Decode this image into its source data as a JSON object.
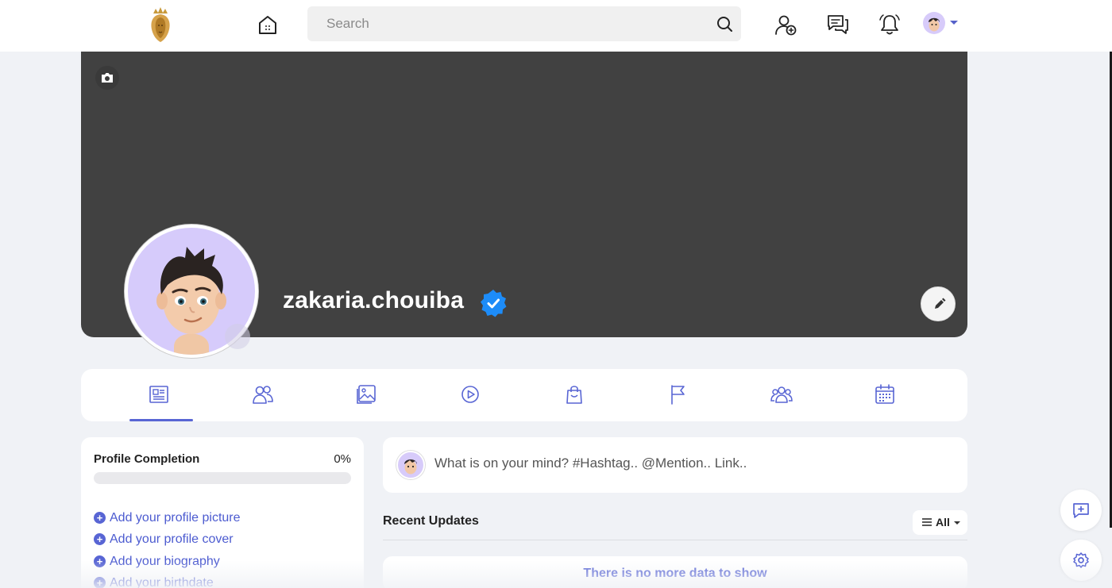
{
  "header": {
    "search_placeholder": "Search"
  },
  "profile": {
    "username": "zakaria.chouiba",
    "verified": true
  },
  "tabs": [
    {
      "icon": "news-feed-icon",
      "active": true
    },
    {
      "icon": "friends-icon"
    },
    {
      "icon": "photos-icon"
    },
    {
      "icon": "videos-icon"
    },
    {
      "icon": "shop-bag-icon"
    },
    {
      "icon": "pages-flag-icon"
    },
    {
      "icon": "groups-icon"
    },
    {
      "icon": "events-calendar-icon"
    }
  ],
  "profile_completion": {
    "title": "Profile Completion",
    "percent_label": "0%",
    "percent": 0,
    "items": [
      "Add your profile picture",
      "Add your profile cover",
      "Add your biography",
      "Add your birthdate"
    ]
  },
  "composer": {
    "placeholder": "What is on your mind? #Hashtag.. @Mention.. Link.."
  },
  "feed": {
    "section_title": "Recent Updates",
    "filter_label": "All",
    "empty_message": "There is no more data to show"
  },
  "colors": {
    "accent": "#5865d4",
    "cover": "#414141",
    "avatar_bg": "#d6cbfb",
    "verified_badge": "#1d8cf8"
  }
}
